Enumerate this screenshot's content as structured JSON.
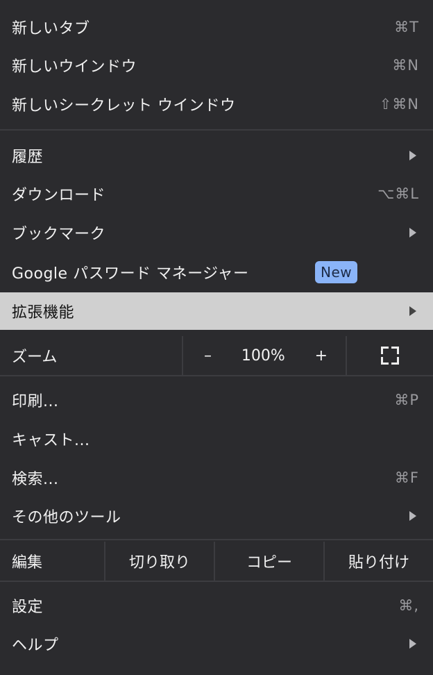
{
  "menu": {
    "new_tab": {
      "label": "新しいタブ",
      "shortcut": "⌘T"
    },
    "new_window": {
      "label": "新しいウインドウ",
      "shortcut": "⌘N"
    },
    "new_incognito": {
      "label": "新しいシークレット ウインドウ",
      "shortcut": "⇧⌘N"
    },
    "history": {
      "label": "履歴"
    },
    "downloads": {
      "label": "ダウンロード",
      "shortcut": "⌥⌘L"
    },
    "bookmarks": {
      "label": "ブックマーク"
    },
    "password_manager": {
      "label": "Google パスワード マネージャー",
      "badge": "New"
    },
    "extensions": {
      "label": "拡張機能"
    },
    "zoom": {
      "label": "ズーム",
      "minus": "–",
      "value": "100%",
      "plus": "+"
    },
    "print": {
      "label": "印刷...",
      "shortcut": "⌘P"
    },
    "cast": {
      "label": "キャスト..."
    },
    "find": {
      "label": "検索...",
      "shortcut": "⌘F"
    },
    "more_tools": {
      "label": "その他のツール"
    },
    "edit": {
      "label": "編集",
      "cut": "切り取り",
      "copy": "コピー",
      "paste": "貼り付け"
    },
    "settings": {
      "label": "設定",
      "shortcut": "⌘,"
    },
    "help": {
      "label": "ヘルプ"
    }
  },
  "colors": {
    "background": "#2b2b2e",
    "highlight": "#d0d0d0",
    "badge": "#8ab4f8"
  }
}
